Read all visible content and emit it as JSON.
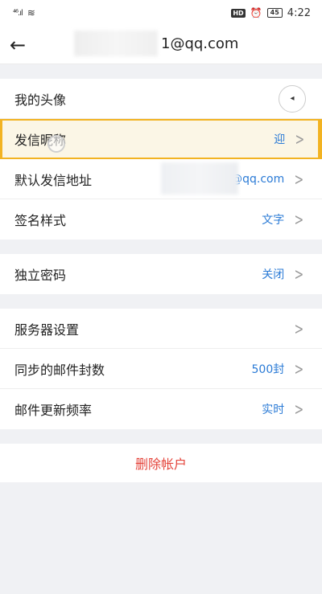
{
  "status_bar": {
    "signal": "⁴⁶.ıl",
    "wifi": "≋",
    "hd": "HD",
    "alarm_icon": "alarm-icon",
    "battery": "45",
    "time": "4:22"
  },
  "header": {
    "back_icon": "arrow-left-icon",
    "title": "1@qq.com"
  },
  "sections": {
    "profile": {
      "avatar_label": "我的头像",
      "nickname_label": "发信昵称",
      "nickname_value": "迎",
      "address_label": "默认发信地址",
      "address_value": "@qq.com",
      "signature_label": "签名样式",
      "signature_value": "文字"
    },
    "security": {
      "password_label": "独立密码",
      "password_value": "关闭"
    },
    "server": {
      "server_label": "服务器设置",
      "sync_label": "同步的邮件封数",
      "sync_value": "500封",
      "freq_label": "邮件更新频率",
      "freq_value": "实时"
    }
  },
  "delete_account": "删除帐户",
  "colors": {
    "accent_blue": "#2b7bd6",
    "highlight_border": "#f2b322",
    "danger_red": "#e4443b"
  }
}
